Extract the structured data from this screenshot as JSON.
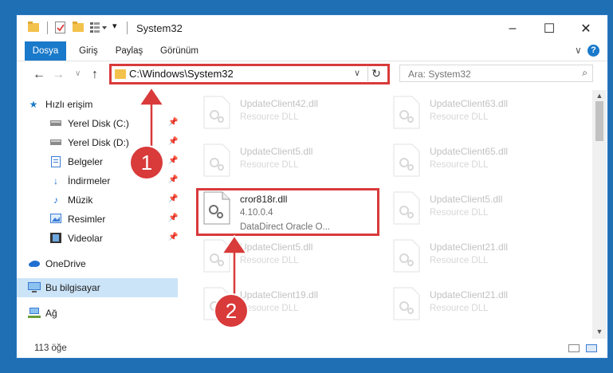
{
  "window": {
    "title": "System32"
  },
  "ribbon": {
    "tabs": [
      "Dosya",
      "Giriş",
      "Paylaş",
      "Görünüm"
    ]
  },
  "address": {
    "path": "C:\\Windows\\System32"
  },
  "search": {
    "placeholder": "Ara: System32"
  },
  "sidebar": {
    "items": [
      {
        "label": "Hızlı erişim",
        "icon": "star-icon",
        "pinned": false
      },
      {
        "label": "Yerel Disk (C:)",
        "icon": "drive-icon",
        "pinned": true
      },
      {
        "label": "Yerel Disk (D:)",
        "icon": "drive-icon",
        "pinned": true
      },
      {
        "label": "Belgeler",
        "icon": "documents-icon",
        "pinned": true
      },
      {
        "label": "İndirmeler",
        "icon": "download-icon",
        "pinned": true
      },
      {
        "label": "Müzik",
        "icon": "music-icon",
        "pinned": true
      },
      {
        "label": "Resimler",
        "icon": "pictures-icon",
        "pinned": true
      },
      {
        "label": "Videolar",
        "icon": "video-icon",
        "pinned": true
      },
      {
        "label": "OneDrive",
        "icon": "cloud-icon",
        "pinned": false
      },
      {
        "label": "Bu bilgisayar",
        "icon": "computer-icon",
        "pinned": false,
        "selected": true
      },
      {
        "label": "Ağ",
        "icon": "network-icon",
        "pinned": false
      }
    ]
  },
  "files": {
    "left": [
      {
        "name": "UpdateClient42.dll",
        "sub": "Resource DLL"
      },
      {
        "name": "UpdateClient5.dll",
        "sub": "Resource DLL"
      },
      {
        "name": "cror818r.dll",
        "sub": "4.10.0.4",
        "sub2": "DataDirect Oracle O..."
      },
      {
        "name": "UpdateClient5.dll",
        "sub": "Resource DLL"
      },
      {
        "name": "UpdateClient19.dll",
        "sub": "Resource DLL"
      }
    ],
    "right": [
      {
        "name": "UpdateClient63.dll",
        "sub": "Resource DLL"
      },
      {
        "name": "UpdateClient65.dll",
        "sub": "Resource DLL"
      },
      {
        "name": "UpdateClient5.dll",
        "sub": "Resource DLL"
      },
      {
        "name": "UpdateClient21.dll",
        "sub": "Resource DLL"
      },
      {
        "name": "UpdateClient21.dll",
        "sub": "Resource DLL"
      }
    ]
  },
  "status": {
    "count": "113 öğe"
  },
  "annotations": {
    "step1": "1",
    "step2": "2"
  },
  "colors": {
    "accent": "#1979ca",
    "highlight": "#d93a3a",
    "folder": "#f3c24c"
  }
}
